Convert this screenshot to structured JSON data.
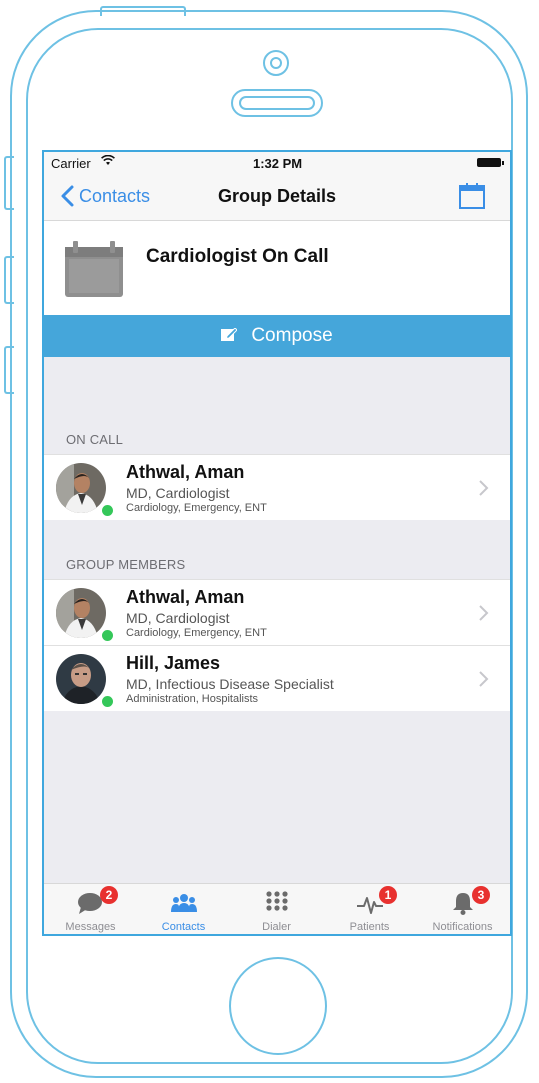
{
  "status_bar": {
    "carrier": "Carrier",
    "time": "1:32 PM"
  },
  "nav": {
    "back_label": "Contacts",
    "title": "Group Details",
    "calendar_icon": "calendar-icon"
  },
  "group": {
    "name": "Cardiologist On Call"
  },
  "compose": {
    "label": "Compose"
  },
  "sections": {
    "on_call": {
      "label": "ON CALL",
      "members": [
        {
          "name": "Athwal, Aman",
          "title": "MD, Cardiologist",
          "departments": "Cardiology, Emergency, ENT",
          "status": "online"
        }
      ]
    },
    "group_members": {
      "label": "GROUP MEMBERS",
      "members": [
        {
          "name": "Athwal, Aman",
          "title": "MD, Cardiologist",
          "departments": "Cardiology, Emergency, ENT",
          "status": "online"
        },
        {
          "name": "Hill, James",
          "title": "MD, Infectious Disease Specialist",
          "departments": "Administration, Hospitalists",
          "status": "online"
        }
      ]
    }
  },
  "tabs": [
    {
      "label": "Messages",
      "icon": "chat-bubble-icon",
      "badge": "2",
      "active": false
    },
    {
      "label": "Contacts",
      "icon": "people-icon",
      "badge": "",
      "active": true
    },
    {
      "label": "Dialer",
      "icon": "keypad-icon",
      "badge": "",
      "active": false
    },
    {
      "label": "Patients",
      "icon": "heartbeat-icon",
      "badge": "1",
      "active": false
    },
    {
      "label": "Notifications",
      "icon": "bell-icon",
      "badge": "3",
      "active": false
    }
  ],
  "colors": {
    "accent": "#3a8ee6",
    "compose_bar": "#45a6da",
    "badge": "#e8312f",
    "online": "#34c759",
    "device_outline": "#6ec1e4"
  }
}
